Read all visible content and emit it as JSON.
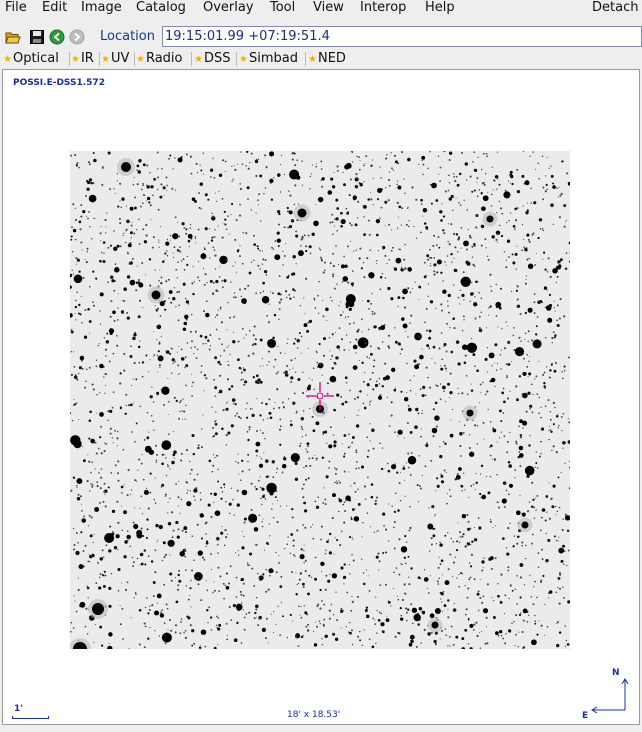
{
  "menu": {
    "items": [
      {
        "id": "file",
        "label": "File"
      },
      {
        "id": "edit",
        "label": "Edit"
      },
      {
        "id": "image",
        "label": "Image"
      },
      {
        "id": "catalog",
        "label": "Catalog"
      },
      {
        "id": "overlay",
        "label": "Overlay"
      },
      {
        "id": "tool",
        "label": "Tool"
      },
      {
        "id": "view",
        "label": "View"
      },
      {
        "id": "interop",
        "label": "Interop"
      },
      {
        "id": "help",
        "label": "Help"
      },
      {
        "id": "detach",
        "label": "Detach"
      }
    ]
  },
  "toolbar": {
    "icons": [
      "open-folder-icon",
      "save-icon",
      "back-icon",
      "forward-icon"
    ],
    "location_label": "Location",
    "location_value": "19:15:01.99 +07:19:51.4"
  },
  "surveys": [
    {
      "id": "optical",
      "label": "Optical"
    },
    {
      "id": "ir",
      "label": "IR"
    },
    {
      "id": "uv",
      "label": "UV"
    },
    {
      "id": "radio",
      "label": "Radio"
    },
    {
      "id": "dss",
      "label": "DSS"
    },
    {
      "id": "simbad",
      "label": "Simbad"
    },
    {
      "id": "ned",
      "label": "NED"
    }
  ],
  "viewer": {
    "image_label": "POSSI.E-DSS1.572",
    "fov": "18' x 18.53'",
    "scale_label": "1'",
    "compass": {
      "north": "N",
      "east": "E"
    }
  },
  "colors": {
    "accent": "#1a2f9a",
    "star_icon": "#f0b400",
    "reticle": "#d4007a"
  }
}
